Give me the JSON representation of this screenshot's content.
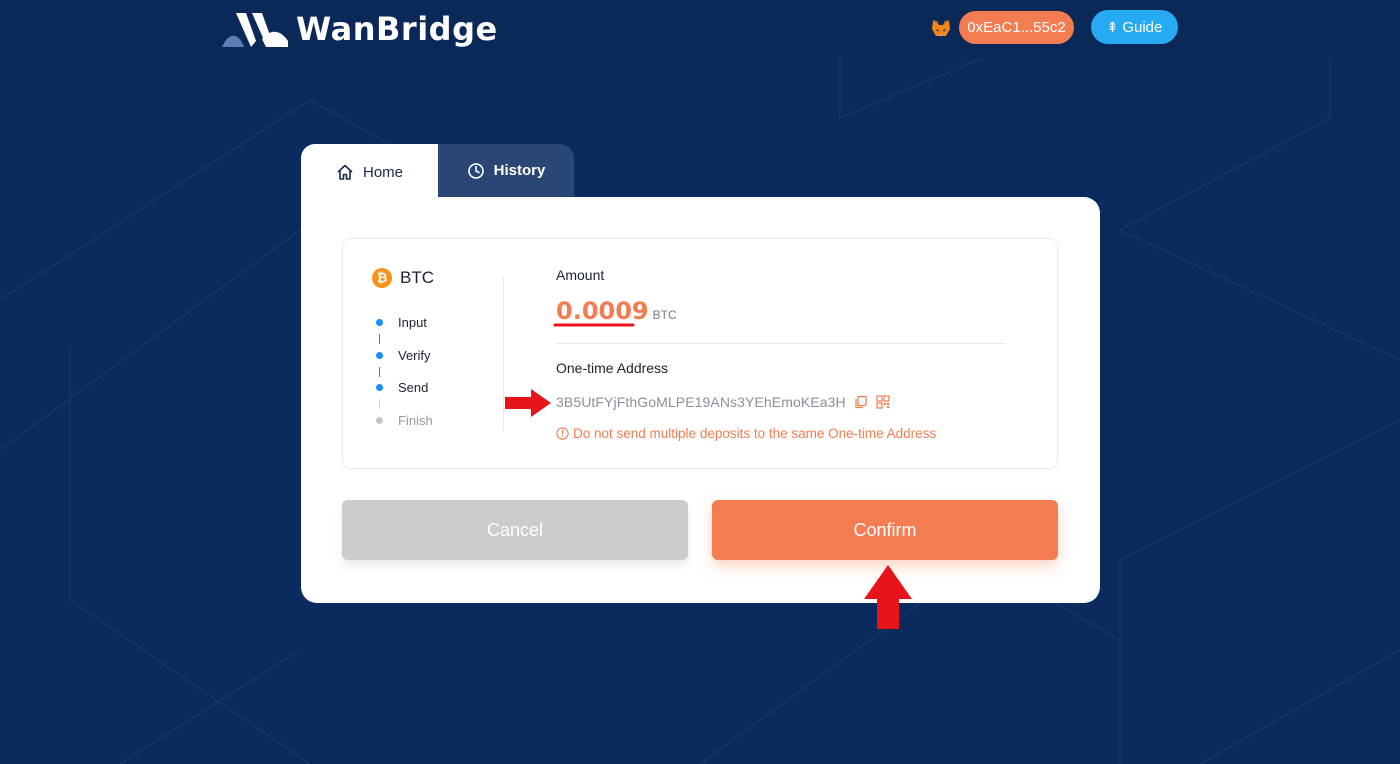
{
  "header": {
    "logo_text": "WanBridge",
    "wallet_icon": "metamask-fox-icon",
    "address": "0xEaC1...55c2",
    "guide_label": "Guide",
    "colors": {
      "background": "#0b2a5e",
      "address_pill": "#f37d51",
      "guide": "#26aaf2"
    }
  },
  "tabs": [
    {
      "label": "Home",
      "icon": "home-icon",
      "active": true
    },
    {
      "label": "History",
      "icon": "clock-icon",
      "active": false
    }
  ],
  "coin": {
    "symbol": "BTC",
    "icon": "bitcoin-icon"
  },
  "steps": [
    {
      "label": "Input",
      "state": "done"
    },
    {
      "label": "Verify",
      "state": "done"
    },
    {
      "label": "Send",
      "state": "current"
    },
    {
      "label": "Finish",
      "state": "pending"
    }
  ],
  "amount": {
    "label": "Amount",
    "value": "0.0009",
    "unit": "BTC"
  },
  "address": {
    "label": "One-time Address",
    "value": "3B5UtFYjFthGoMLPE19ANs3YEhEmoKEa3H",
    "warning": "Do not send multiple deposits to the same One-time Address"
  },
  "buttons": {
    "cancel": "Cancel",
    "confirm": "Confirm"
  },
  "accent_colors": {
    "orange": "#f37d51",
    "blue": "#1890ff",
    "annotation_red": "#e8141b"
  }
}
